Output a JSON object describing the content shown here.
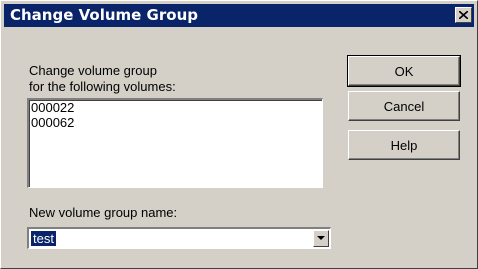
{
  "window": {
    "title": "Change Volume Group"
  },
  "instructions": {
    "line1": "Change volume group",
    "line2": "for the following volumes:"
  },
  "volumes": [
    "000022",
    "000062"
  ],
  "new_name": {
    "label": "New volume group name:",
    "value": "test"
  },
  "buttons": {
    "ok": "OK",
    "cancel": "Cancel",
    "help": "Help"
  },
  "icons": {
    "close": "close-icon",
    "dropdown": "chevron-down-icon"
  },
  "colors": {
    "titlebar": "#0a246a",
    "face": "#d4d0c8",
    "selection": "#0a246a"
  }
}
